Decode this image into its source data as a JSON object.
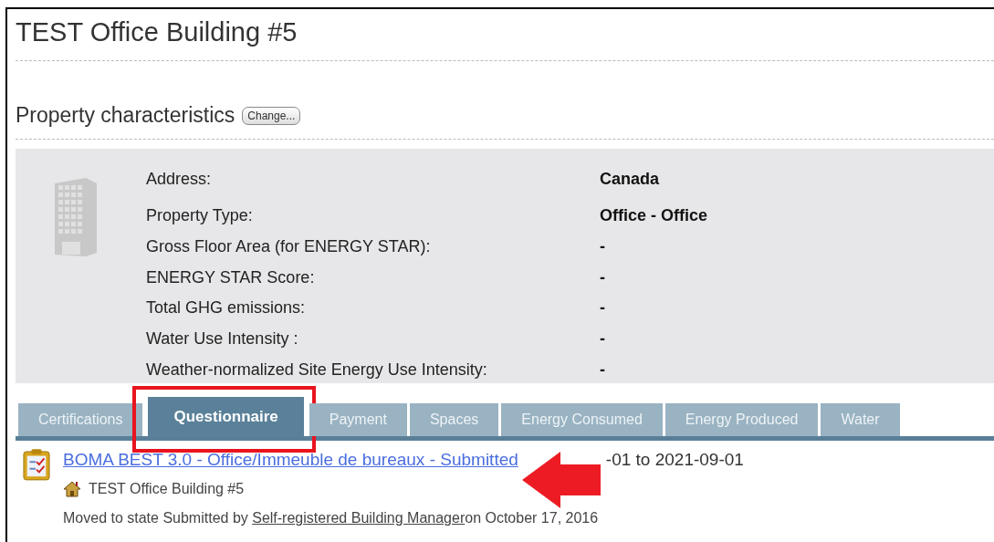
{
  "page_title": "TEST Office Building #5",
  "section": {
    "title": "Property characteristics",
    "button": "Change..."
  },
  "characteristics": [
    {
      "label": "Address:",
      "value": "Canada"
    },
    {
      "label": "Property Type:",
      "value": "Office - Office"
    },
    {
      "label": "Gross Floor Area (for ENERGY STAR):",
      "value": "-"
    },
    {
      "label": "ENERGY STAR Score:",
      "value": "-"
    },
    {
      "label": "Total GHG emissions:",
      "value": "-"
    },
    {
      "label": "Water Use Intensity :",
      "value": "-"
    },
    {
      "label": "Weather-normalized Site Energy Use Intensity:",
      "value": "-"
    }
  ],
  "tabs": [
    {
      "label": "Certifications",
      "selected": false
    },
    {
      "label": "Questionnaire",
      "selected": true
    },
    {
      "label": "Payment",
      "selected": false
    },
    {
      "label": "Spaces",
      "selected": false
    },
    {
      "label": "Energy Consumed",
      "selected": false
    },
    {
      "label": "Energy Produced",
      "selected": false
    },
    {
      "label": "Water",
      "selected": false
    }
  ],
  "questionnaire": {
    "link": "BOMA BEST 3.0 - Office/Immeuble de bureaux - Submitted",
    "period": "-01 to 2021-09-01",
    "property": "TEST Office Building #5",
    "history_prefix": "Moved to state Submitted by ",
    "history_link": "Self-registered Building Manager",
    "history_suffix": "on October 17, 2016"
  }
}
